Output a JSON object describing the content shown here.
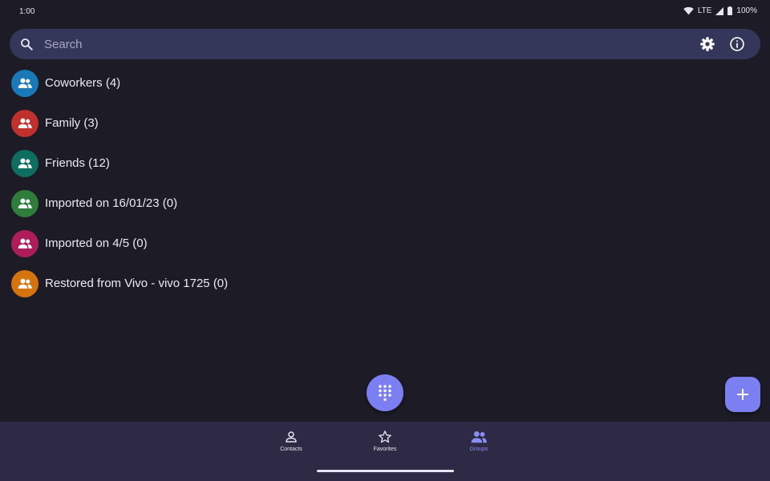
{
  "status_bar": {
    "time": "1:00",
    "network": "LTE",
    "battery": "100%"
  },
  "search": {
    "placeholder": "Search"
  },
  "groups": [
    {
      "label": "Coworkers (4)",
      "color": "#1a7ab8"
    },
    {
      "label": "Family (3)",
      "color": "#c0302d"
    },
    {
      "label": "Friends (12)",
      "color": "#0f6e62"
    },
    {
      "label": "Imported on 16/01/23 (0)",
      "color": "#2e7d3a"
    },
    {
      "label": "Imported on 4/5 (0)",
      "color": "#ad1d5a"
    },
    {
      "label": "Restored from Vivo - vivo 1725 (0)",
      "color": "#d3740f"
    }
  ],
  "nav": {
    "contacts": "Contacts",
    "favorites": "Favorites",
    "groups": "Groups"
  },
  "colors": {
    "accent": "#7b7ff2",
    "background": "#1c1b26",
    "search_bg": "#343759",
    "nav_bg": "#2e2944"
  },
  "icons": {
    "search": "search-icon",
    "settings": "gear-icon",
    "info": "info-icon",
    "group": "people-icon",
    "dialpad": "dialpad-icon",
    "add": "plus-icon"
  }
}
